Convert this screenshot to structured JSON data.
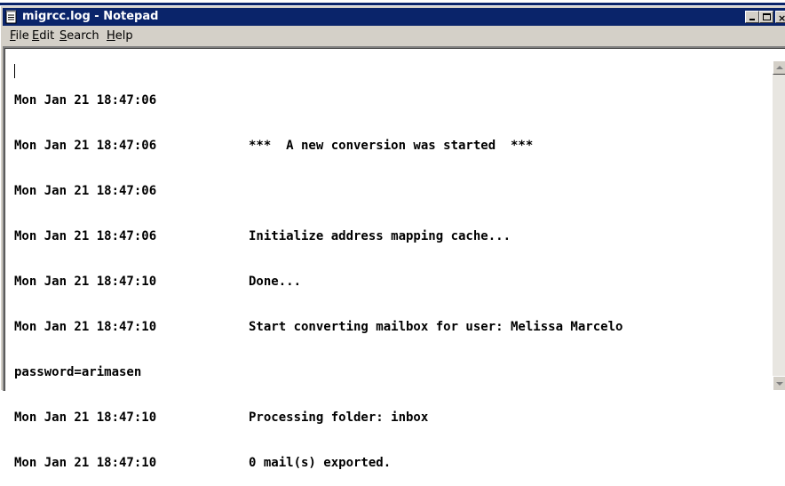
{
  "window": {
    "title": "migrcc.log - Notepad",
    "icon": "notepad-icon",
    "title_color": "#0a246a",
    "face_color": "#d4d0c8",
    "controls": [
      "minimize-icon",
      "maximize-icon",
      "close-icon"
    ]
  },
  "menu": {
    "file": {
      "mnemonic": "F",
      "rest": "ile"
    },
    "edit": {
      "mnemonic": "E",
      "rest": "dit"
    },
    "search": {
      "mnemonic": "S",
      "rest": "earch"
    },
    "help": {
      "mnemonic": "H",
      "rest": "elp"
    }
  },
  "log": {
    "lines": [
      {
        "timestamp": "Mon Jan 21 18:47:06",
        "message": ""
      },
      {
        "timestamp": "Mon Jan 21 18:47:06",
        "message": "***  A new conversion was started  ***"
      },
      {
        "timestamp": "Mon Jan 21 18:47:06",
        "message": ""
      },
      {
        "timestamp": "Mon Jan 21 18:47:06",
        "message": "Initialize address mapping cache..."
      },
      {
        "timestamp": "Mon Jan 21 18:47:10",
        "message": "Done..."
      },
      {
        "timestamp": "Mon Jan 21 18:47:10",
        "message": "Start converting mailbox for user: Melissa Marcelo"
      },
      {
        "timestamp": "password=arimasen",
        "message": ""
      },
      {
        "timestamp": "Mon Jan 21 18:47:10",
        "message": "Processing folder: inbox"
      },
      {
        "timestamp": "Mon Jan 21 18:47:10",
        "message": "0 mail(s) exported."
      }
    ]
  },
  "scrollbar": {
    "up_icon": "scroll-up-arrow-icon",
    "down_icon": "scroll-down-arrow-icon"
  }
}
